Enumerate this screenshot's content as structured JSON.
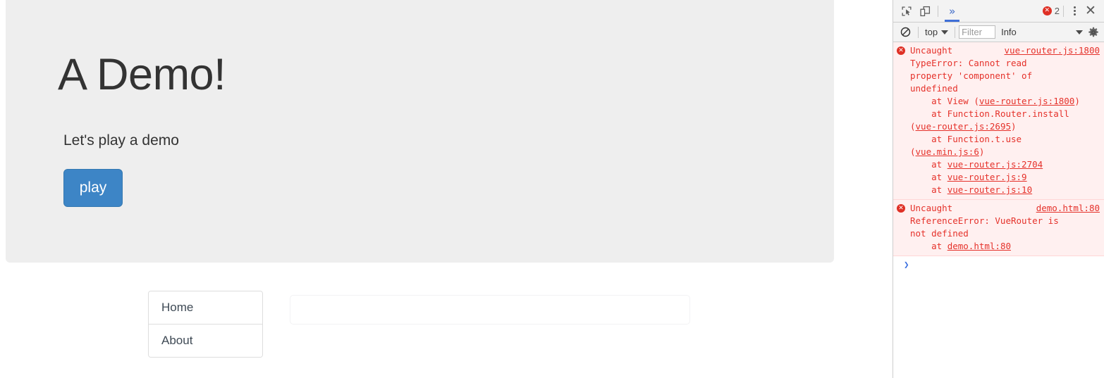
{
  "page": {
    "jumbotron": {
      "title": "A Demo!",
      "subtitle": "Let's play a demo",
      "play_button": "play"
    },
    "nav_list": {
      "items": [
        {
          "label": "Home"
        },
        {
          "label": "About"
        }
      ]
    },
    "router_view": {
      "content": ""
    }
  },
  "devtools": {
    "toolbar": {
      "inspect_icon": "inspect-element-icon",
      "device_icon": "device-toolbar-icon",
      "more_tabs_label": "»",
      "error_count": "2",
      "menu_icon": "kebab-menu-icon",
      "close_label": "✕"
    },
    "filterbar": {
      "clear_icon": "clear-console-icon",
      "context": "top",
      "filter_placeholder": "Filter",
      "level": "Info",
      "settings_icon": "settings-gear-icon"
    },
    "console": {
      "messages": [
        {
          "icon": "error-icon",
          "title": "Uncaught",
          "source": "vue-router.js:1800",
          "body_pre": "TypeError: Cannot read property 'component' of undefined\n    at View (",
          "stack": [
            {
              "pre": "TypeError: Cannot read",
              "text": ""
            }
          ],
          "lines": [
            {
              "type": "text",
              "text": "TypeError: Cannot read"
            },
            {
              "type": "text",
              "text": "property 'component' of"
            },
            {
              "type": "text",
              "text": "undefined"
            },
            {
              "type": "frame",
              "pre": "    at View (",
              "link": "vue-router.js:1800",
              "post": ")"
            },
            {
              "type": "frame",
              "pre": "    at Function.Router.install (",
              "link": "vue-router.js:2695",
              "post": ")"
            },
            {
              "type": "frame",
              "pre": "    at Function.t.use (",
              "link": "vue.min.js:6",
              "post": ")"
            },
            {
              "type": "frame",
              "pre": "    at ",
              "link": "vue-router.js:2704",
              "post": ""
            },
            {
              "type": "frame",
              "pre": "    at ",
              "link": "vue-router.js:9",
              "post": ""
            },
            {
              "type": "frame",
              "pre": "    at ",
              "link": "vue-router.js:10",
              "post": ""
            }
          ]
        },
        {
          "icon": "error-icon",
          "title": "Uncaught",
          "source": "demo.html:80",
          "lines": [
            {
              "type": "text",
              "text": "ReferenceError: VueRouter is"
            },
            {
              "type": "text",
              "text": "not defined"
            },
            {
              "type": "frame",
              "pre": "    at ",
              "link": "demo.html:80",
              "post": ""
            }
          ]
        }
      ],
      "prompt_caret": "❯"
    }
  },
  "colors": {
    "jumbotron_bg": "#eeeeee",
    "primary_button": "#3d85c6",
    "error_text": "#e5312a",
    "error_bg": "#fff0f0",
    "devtools_chrome": "#f3f3f3",
    "link_blue": "#3a6fe0"
  }
}
